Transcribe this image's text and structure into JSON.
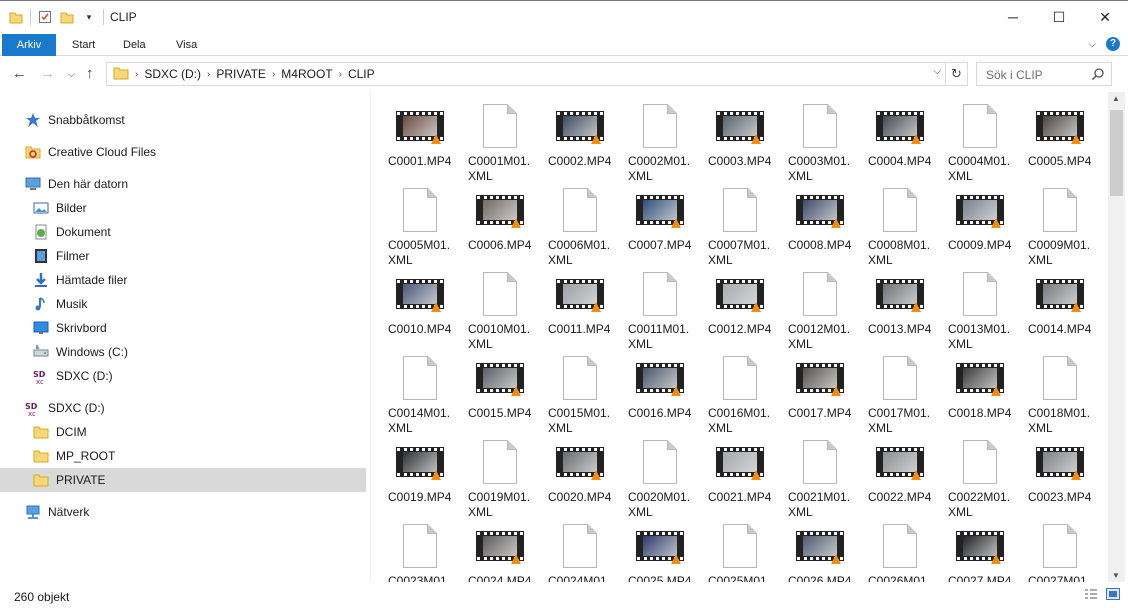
{
  "window": {
    "title": "CLIP"
  },
  "ribbon": {
    "tabs": [
      "Arkiv",
      "Start",
      "Dela",
      "Visa"
    ]
  },
  "address": {
    "crumbs": [
      "SDXC (D:)",
      "PRIVATE",
      "M4ROOT",
      "CLIP"
    ]
  },
  "search": {
    "placeholder": "Sök i CLIP"
  },
  "sidebar": {
    "items": [
      {
        "label": "Snabbåtkomst",
        "icon": "star-icon",
        "indent": 0
      },
      {
        "label": "Creative Cloud Files",
        "icon": "creative-cloud-folder-icon",
        "indent": 0
      },
      {
        "label": "Den här datorn",
        "icon": "computer-icon",
        "indent": 0
      },
      {
        "label": "Bilder",
        "icon": "pictures-icon",
        "indent": 1
      },
      {
        "label": "Dokument",
        "icon": "documents-icon",
        "indent": 1
      },
      {
        "label": "Filmer",
        "icon": "videos-icon",
        "indent": 1
      },
      {
        "label": "Hämtade filer",
        "icon": "downloads-icon",
        "indent": 1
      },
      {
        "label": "Musik",
        "icon": "music-icon",
        "indent": 1
      },
      {
        "label": "Skrivbord",
        "icon": "desktop-icon",
        "indent": 1
      },
      {
        "label": "Windows (C:)",
        "icon": "drive-icon",
        "indent": 1
      },
      {
        "label": "SDXC (D:)",
        "icon": "sd-card-icon",
        "indent": 1
      },
      {
        "label": "SDXC (D:)",
        "icon": "sd-card-icon",
        "indent": 0
      },
      {
        "label": "DCIM",
        "icon": "folder-icon",
        "indent": 1
      },
      {
        "label": "MP_ROOT",
        "icon": "folder-icon",
        "indent": 1
      },
      {
        "label": "PRIVATE",
        "icon": "folder-icon",
        "indent": 1,
        "selected": true
      },
      {
        "label": "Nätverk",
        "icon": "network-icon",
        "indent": 0
      }
    ]
  },
  "files": [
    {
      "name": "C0001.MP4",
      "type": "mp4",
      "tint": "#6a4a3e"
    },
    {
      "name": "C0001M01.\nXML",
      "type": "xml"
    },
    {
      "name": "C0002.MP4",
      "type": "mp4",
      "tint": "#3c4a5c"
    },
    {
      "name": "C0002M01.\nXML",
      "type": "xml"
    },
    {
      "name": "C0003.MP4",
      "type": "mp4",
      "tint": "#59626e"
    },
    {
      "name": "C0003M01.\nXML",
      "type": "xml"
    },
    {
      "name": "C0004.MP4",
      "type": "mp4",
      "tint": "#444a52"
    },
    {
      "name": "C0004M01.\nXML",
      "type": "xml"
    },
    {
      "name": "C0005.MP4",
      "type": "mp4",
      "tint": "#4a4440"
    },
    {
      "name": "C0005M01.\nXML",
      "type": "xml"
    },
    {
      "name": "C0006.MP4",
      "type": "mp4",
      "tint": "#6f6a62"
    },
    {
      "name": "C0006M01.\nXML",
      "type": "xml"
    },
    {
      "name": "C0007.MP4",
      "type": "mp4",
      "tint": "#2f4f7a"
    },
    {
      "name": "C0007M01.\nXML",
      "type": "xml"
    },
    {
      "name": "C0008.MP4",
      "type": "mp4",
      "tint": "#3d4a6a"
    },
    {
      "name": "C0008M01.\nXML",
      "type": "xml"
    },
    {
      "name": "C0009.MP4",
      "type": "mp4",
      "tint": "#7a8290"
    },
    {
      "name": "C0009M01.\nXML",
      "type": "xml"
    },
    {
      "name": "C0010.MP4",
      "type": "mp4",
      "tint": "#4a5a7a"
    },
    {
      "name": "C0010M01.\nXML",
      "type": "xml"
    },
    {
      "name": "C0011.MP4",
      "type": "mp4",
      "tint": "#9aa0a6"
    },
    {
      "name": "C0011M01.\nXML",
      "type": "xml"
    },
    {
      "name": "C0012.MP4",
      "type": "mp4",
      "tint": "#a8acb0"
    },
    {
      "name": "C0012M01.\nXML",
      "type": "xml"
    },
    {
      "name": "C0013.MP4",
      "type": "mp4",
      "tint": "#6e7278"
    },
    {
      "name": "C0013M01.\nXML",
      "type": "xml"
    },
    {
      "name": "C0014.MP4",
      "type": "mp4",
      "tint": "#767a80"
    },
    {
      "name": "C0014M01.\nXML",
      "type": "xml"
    },
    {
      "name": "C0015.MP4",
      "type": "mp4",
      "tint": "#5a5e64"
    },
    {
      "name": "C0015M01.\nXML",
      "type": "xml"
    },
    {
      "name": "C0016.MP4",
      "type": "mp4",
      "tint": "#48566a"
    },
    {
      "name": "C0016M01.\nXML",
      "type": "xml"
    },
    {
      "name": "C0017.MP4",
      "type": "mp4",
      "tint": "#54504c"
    },
    {
      "name": "C0017M01.\nXML",
      "type": "xml"
    },
    {
      "name": "C0018.MP4",
      "type": "mp4",
      "tint": "#3a3a3a"
    },
    {
      "name": "C0018M01.\nXML",
      "type": "xml"
    },
    {
      "name": "C0019.MP4",
      "type": "mp4",
      "tint": "#2e3034"
    },
    {
      "name": "C0019M01.\nXML",
      "type": "xml"
    },
    {
      "name": "C0020.MP4",
      "type": "mp4",
      "tint": "#686c70"
    },
    {
      "name": "C0020M01.\nXML",
      "type": "xml"
    },
    {
      "name": "C0021.MP4",
      "type": "mp4",
      "tint": "#a4a8ac"
    },
    {
      "name": "C0021M01.\nXML",
      "type": "xml"
    },
    {
      "name": "C0022.MP4",
      "type": "mp4",
      "tint": "#8a8e92"
    },
    {
      "name": "C0022M01.\nXML",
      "type": "xml"
    },
    {
      "name": "C0023.MP4",
      "type": "mp4",
      "tint": "#7e8286"
    },
    {
      "name": "C0023M01.",
      "type": "xml"
    },
    {
      "name": "C0024.MP4",
      "type": "mp4",
      "tint": "#5c5a58"
    },
    {
      "name": "C0024M01.",
      "type": "xml"
    },
    {
      "name": "C0025.MP4",
      "type": "mp4",
      "tint": "#2a3a6a"
    },
    {
      "name": "C0025M01.",
      "type": "xml"
    },
    {
      "name": "C0026.MP4",
      "type": "mp4",
      "tint": "#4e5a70"
    },
    {
      "name": "C0026M01.",
      "type": "xml"
    },
    {
      "name": "C0027.MP4",
      "type": "mp4",
      "tint": "#1e2024"
    },
    {
      "name": "C0027M01.",
      "type": "xml"
    }
  ],
  "status": {
    "count": "260 objekt"
  },
  "colors": {
    "accent": "#1979ca",
    "selected": "#d9d9d9",
    "vlc": "#f28c0f"
  }
}
